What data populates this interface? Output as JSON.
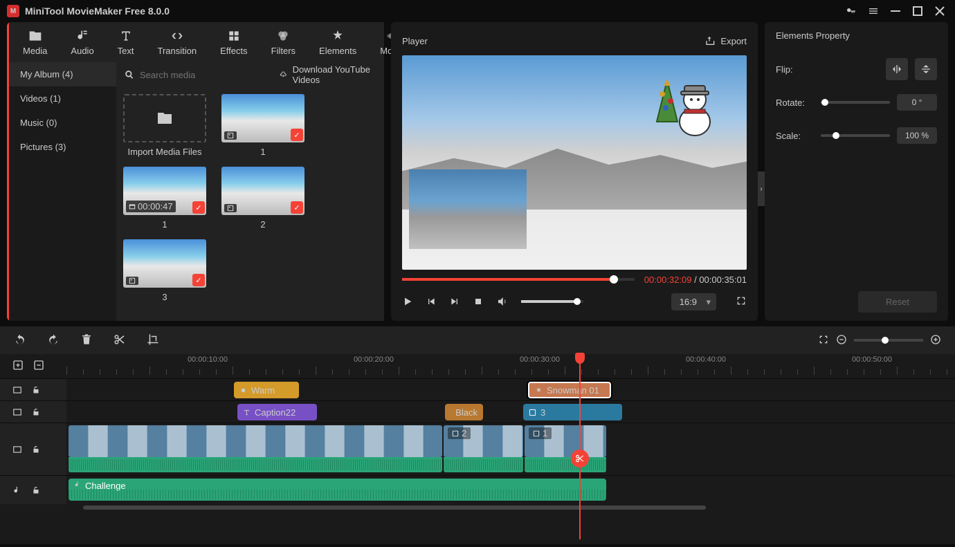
{
  "app": {
    "title": "MiniTool MovieMaker Free 8.0.0"
  },
  "tabs": {
    "media": "Media",
    "audio": "Audio",
    "text": "Text",
    "transition": "Transition",
    "effects": "Effects",
    "filters": "Filters",
    "elements": "Elements",
    "motion": "Motion"
  },
  "sidebar": {
    "myalbum": "My Album (4)",
    "videos": "Videos (1)",
    "music": "Music (0)",
    "pictures": "Pictures (3)"
  },
  "search": {
    "placeholder": "Search media",
    "download": "Download YouTube Videos"
  },
  "media": {
    "import": "Import Media Files",
    "item1": "1",
    "item2": "1",
    "item2_dur": "00:00:47",
    "item3": "2",
    "item4": "3"
  },
  "player": {
    "title": "Player",
    "export": "Export",
    "current": "00:00:32:09",
    "total": "00:00:35:01",
    "aspect": "16:9"
  },
  "props": {
    "title": "Elements Property",
    "flip": "Flip:",
    "rotate": "Rotate:",
    "rotate_val": "0 °",
    "scale": "Scale:",
    "scale_val": "100 %",
    "reset": "Reset"
  },
  "ruler": {
    "t10": "00:00:10:00",
    "t20": "00:00:20:00",
    "t30": "00:00:30:00",
    "t40": "00:00:40:00",
    "t50": "00:00:50:00"
  },
  "clips": {
    "warm": "Warm",
    "snowman": "Snowman 01",
    "caption": "Caption22",
    "black": "Black",
    "pic3": "3",
    "pic2": "2",
    "pic1": "1",
    "challenge": "Challenge"
  }
}
